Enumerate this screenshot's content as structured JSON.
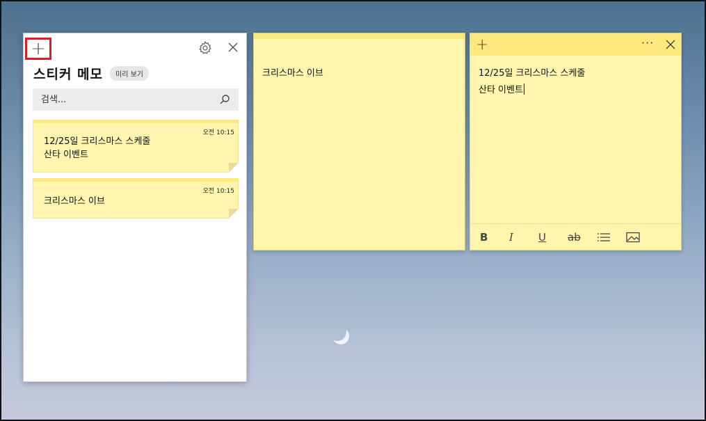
{
  "list_panel": {
    "title": "스티커 메모",
    "preview_label": "미리 보기",
    "search_placeholder": "검색...",
    "cards": [
      {
        "time": "오전 10:15",
        "lines": [
          "12/25일 크리스마스 스케줄",
          "산타 이벤트"
        ]
      },
      {
        "time": "오전 10:15",
        "lines": [
          "크리스마스 이브"
        ]
      }
    ]
  },
  "note1": {
    "text": "크리스마스 이브"
  },
  "note2": {
    "lines": [
      "12/25일 크리스마스 스케줄",
      "산타 이벤트"
    ],
    "more_label": "···",
    "toolbar": {
      "bold": "B",
      "italic": "I",
      "underline": "U",
      "strike": "ab"
    }
  },
  "colors": {
    "note_bg": "#fff5ae",
    "note_header": "#fde97d",
    "highlight": "#e01b24"
  }
}
